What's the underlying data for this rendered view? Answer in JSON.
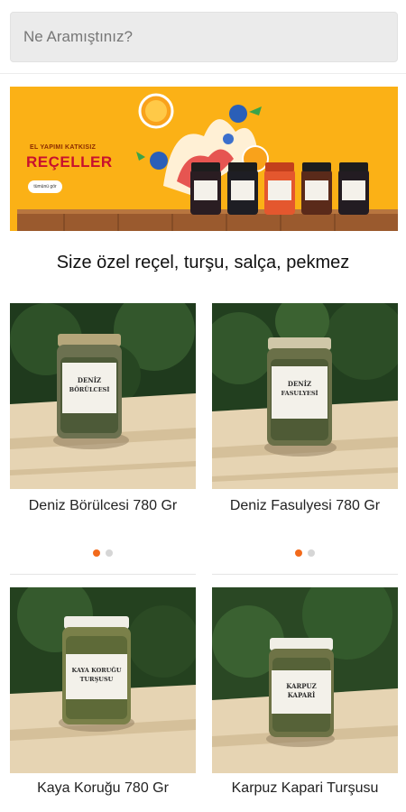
{
  "search": {
    "placeholder": "Ne Aramıştınız?"
  },
  "banner": {
    "subtitle": "EL YAPIMI KATKISIZ",
    "title": "REÇELLER",
    "button": "tümünü gör"
  },
  "tagline": "Size özel reçel, turşu, salça, pekmez",
  "products": [
    {
      "name": "Deniz Börülcesi 780 Gr",
      "jar_label": [
        "DENİZ",
        "BÖRÜLCESİ"
      ],
      "slides": 2,
      "active_slide": 1
    },
    {
      "name": "Deniz Fasulyesi 780 Gr",
      "jar_label": [
        "DENİZ",
        "FASULYESİ"
      ],
      "slides": 2,
      "active_slide": 1
    },
    {
      "name": "Kaya Koruğu 780 Gr",
      "jar_label": [
        "KAYA KORUĞU",
        "TURŞUSU"
      ]
    },
    {
      "name": "Karpuz Kapari Turşusu",
      "jar_label": [
        "KARPUZ",
        "KAPARİ"
      ]
    }
  ],
  "colors": {
    "accent": "#f26a1b",
    "banner_bg": "#fbb116",
    "banner_title": "#c8102e"
  }
}
